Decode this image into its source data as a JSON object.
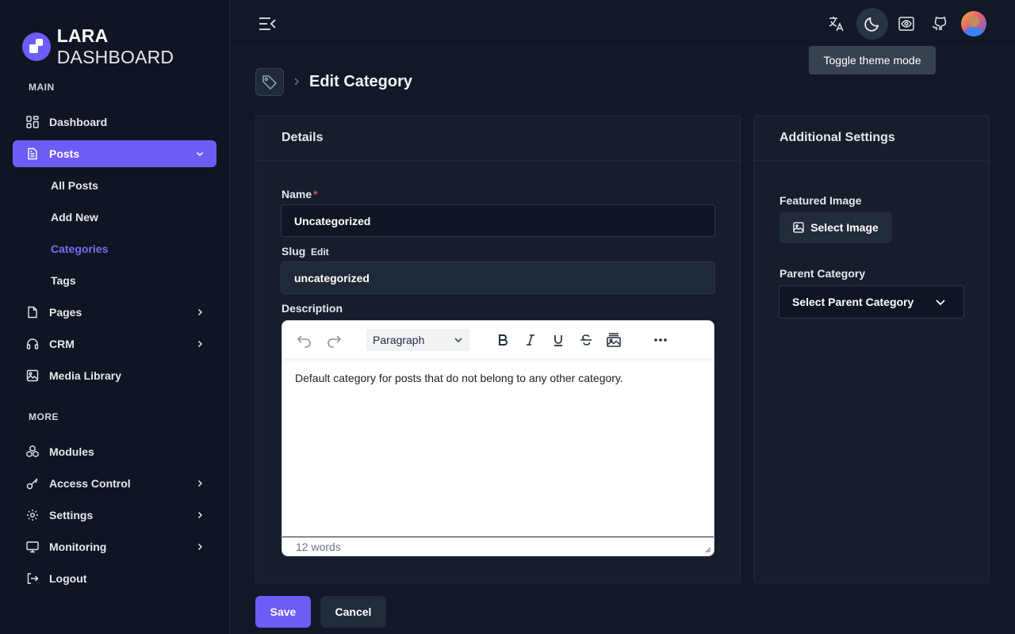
{
  "brand": {
    "bold": "LARA",
    "light": "DASHBOARD"
  },
  "sidebar": {
    "sections": {
      "main": "MAIN",
      "more": "MORE"
    },
    "items": {
      "dashboard": "Dashboard",
      "posts": "Posts",
      "pages": "Pages",
      "crm": "CRM",
      "media": "Media Library",
      "modules": "Modules",
      "access": "Access Control",
      "settings": "Settings",
      "monitoring": "Monitoring",
      "logout": "Logout"
    },
    "posts_sub": {
      "all": "All Posts",
      "add": "Add New",
      "categories": "Categories",
      "tags": "Tags"
    }
  },
  "header": {
    "tooltip": "Toggle theme mode",
    "icons": [
      "menu-collapse-icon",
      "translate-icon",
      "moon-icon",
      "eye-icon",
      "github-icon"
    ]
  },
  "page": {
    "title": "Edit Category"
  },
  "details": {
    "title": "Details",
    "name_label": "Name",
    "name_required": "*",
    "name_value": "Uncategorized",
    "slug_label": "Slug",
    "slug_edit": "Edit",
    "slug_value": "uncategorized",
    "description_label": "Description"
  },
  "editor": {
    "block_format": "Paragraph",
    "content": "Default category for posts that do not belong to any other category.",
    "word_count": "12 words"
  },
  "additional": {
    "title": "Additional Settings",
    "featured_label": "Featured Image",
    "select_image": "Select Image",
    "parent_label": "Parent Category",
    "parent_placeholder": "Select Parent Category"
  },
  "actions": {
    "save": "Save",
    "cancel": "Cancel"
  },
  "colors": {
    "accent": "#6d5cf6",
    "background": "#111827",
    "sidebar": "#0f1522",
    "required": "#ef4444"
  }
}
